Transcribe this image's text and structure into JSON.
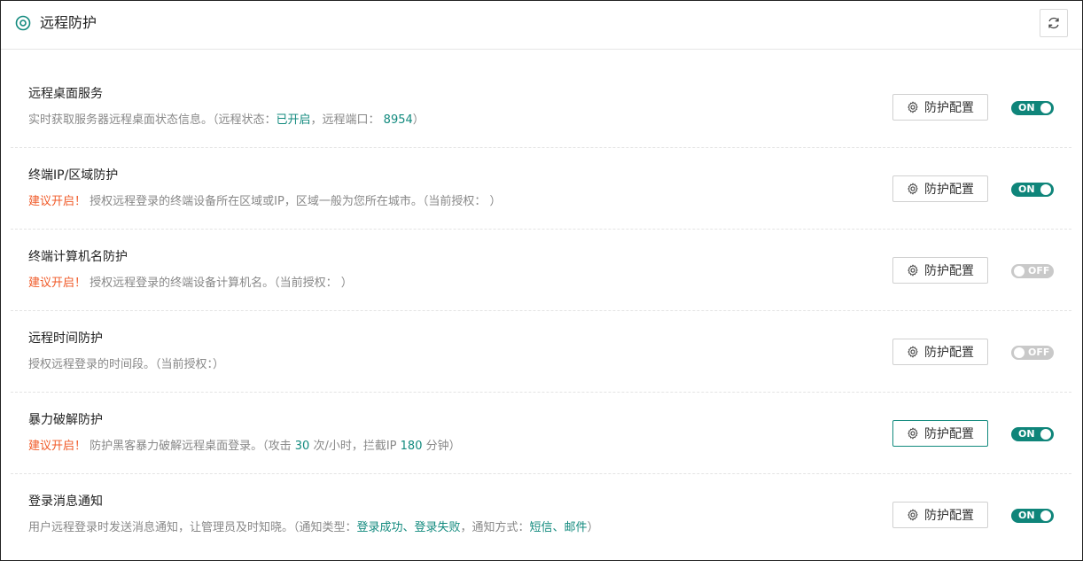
{
  "header": {
    "title": "远程防护",
    "icon": "target-icon",
    "refresh_icon": "refresh-icon"
  },
  "config_label": "防护配置",
  "items": [
    {
      "title": "远程桌面服务",
      "desc": [
        {
          "text": "实时获取服务器远程桌面状态信息。（远程状态：",
          "style": "plain"
        },
        {
          "text": "已开启",
          "style": "hl"
        },
        {
          "text": "，远程端口： ",
          "style": "plain"
        },
        {
          "text": "8954",
          "style": "hl"
        },
        {
          "text": "）",
          "style": "plain"
        }
      ],
      "toggle": {
        "state": "on",
        "label": "ON"
      }
    },
    {
      "title": "终端IP/区域防护",
      "desc": [
        {
          "text": "建议开启！",
          "style": "warn"
        },
        {
          "text": " 授权远程登录的终端设备所在区域或IP，区域一般为您所在城市。（当前授权： ）",
          "style": "plain"
        }
      ],
      "toggle": {
        "state": "on",
        "label": "ON"
      }
    },
    {
      "title": "终端计算机名防护",
      "desc": [
        {
          "text": "建议开启！",
          "style": "warn"
        },
        {
          "text": " 授权远程登录的终端设备计算机名。（当前授权： ）",
          "style": "plain"
        }
      ],
      "toggle": {
        "state": "off",
        "label": "OFF"
      }
    },
    {
      "title": "远程时间防护",
      "desc": [
        {
          "text": "授权远程登录的时间段。（当前授权：）",
          "style": "plain"
        }
      ],
      "toggle": {
        "state": "off",
        "label": "OFF"
      }
    },
    {
      "title": "暴力破解防护",
      "desc": [
        {
          "text": "建议开启！",
          "style": "warn"
        },
        {
          "text": "  防护黑客暴力破解远程桌面登录。（攻击 ",
          "style": "plain"
        },
        {
          "text": "30",
          "style": "hl"
        },
        {
          "text": " 次/小时，拦截IP ",
          "style": "plain"
        },
        {
          "text": "180",
          "style": "hl"
        },
        {
          "text": " 分钟）",
          "style": "plain"
        }
      ],
      "toggle": {
        "state": "on",
        "label": "ON"
      },
      "config_active": true
    },
    {
      "title": "登录消息通知",
      "desc": [
        {
          "text": "用户远程登录时发送消息通知，让管理员及时知晓。（通知类型：",
          "style": "plain"
        },
        {
          "text": "登录成功、登录失败",
          "style": "hl"
        },
        {
          "text": "，通知方式：",
          "style": "plain"
        },
        {
          "text": "短信、邮件",
          "style": "hl"
        },
        {
          "text": "）",
          "style": "plain"
        }
      ],
      "toggle": {
        "state": "on",
        "label": "ON"
      }
    }
  ],
  "colors": {
    "accent": "#0f857a",
    "warn": "#f05a28",
    "muted": "#888888",
    "off": "#c9c9c9"
  }
}
